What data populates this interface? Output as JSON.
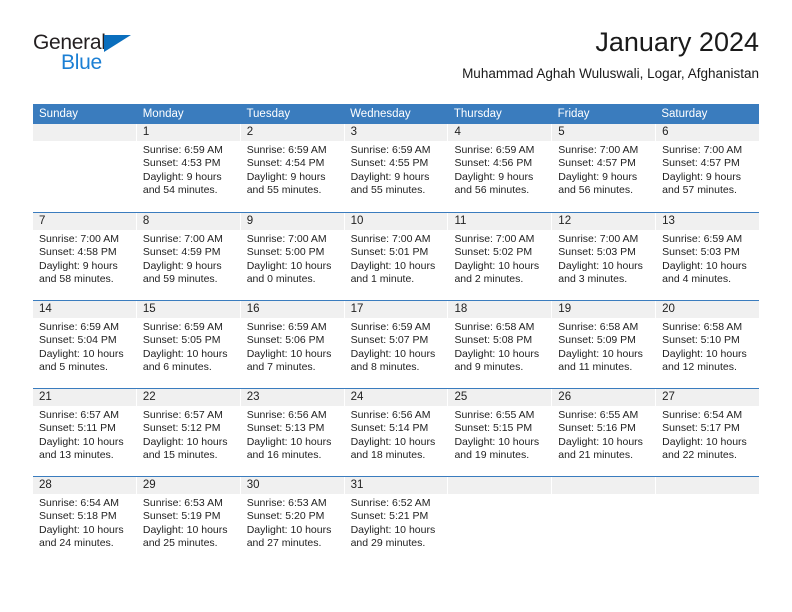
{
  "brand": {
    "name_top": "General",
    "name_bottom": "Blue",
    "triangle_icon": "brand-triangle-icon",
    "color_dark": "#231f20",
    "color_blue": "#1b7fd4"
  },
  "header": {
    "title": "January 2024",
    "subtitle": "Muhammad Aghah Wuluswali, Logar, Afghanistan"
  },
  "theme": {
    "header_blue": "#3a7cbe",
    "daynum_gray": "#f0f0f0",
    "text": "#222222"
  },
  "calendar": {
    "weekdays": [
      "Sunday",
      "Monday",
      "Tuesday",
      "Wednesday",
      "Thursday",
      "Friday",
      "Saturday"
    ],
    "weeks": [
      [
        {
          "day": "",
          "sunrise": "",
          "sunset": "",
          "daylight": ""
        },
        {
          "day": "1",
          "sunrise": "Sunrise: 6:59 AM",
          "sunset": "Sunset: 4:53 PM",
          "daylight": "Daylight: 9 hours and 54 minutes."
        },
        {
          "day": "2",
          "sunrise": "Sunrise: 6:59 AM",
          "sunset": "Sunset: 4:54 PM",
          "daylight": "Daylight: 9 hours and 55 minutes."
        },
        {
          "day": "3",
          "sunrise": "Sunrise: 6:59 AM",
          "sunset": "Sunset: 4:55 PM",
          "daylight": "Daylight: 9 hours and 55 minutes."
        },
        {
          "day": "4",
          "sunrise": "Sunrise: 6:59 AM",
          "sunset": "Sunset: 4:56 PM",
          "daylight": "Daylight: 9 hours and 56 minutes."
        },
        {
          "day": "5",
          "sunrise": "Sunrise: 7:00 AM",
          "sunset": "Sunset: 4:57 PM",
          "daylight": "Daylight: 9 hours and 56 minutes."
        },
        {
          "day": "6",
          "sunrise": "Sunrise: 7:00 AM",
          "sunset": "Sunset: 4:57 PM",
          "daylight": "Daylight: 9 hours and 57 minutes."
        }
      ],
      [
        {
          "day": "7",
          "sunrise": "Sunrise: 7:00 AM",
          "sunset": "Sunset: 4:58 PM",
          "daylight": "Daylight: 9 hours and 58 minutes."
        },
        {
          "day": "8",
          "sunrise": "Sunrise: 7:00 AM",
          "sunset": "Sunset: 4:59 PM",
          "daylight": "Daylight: 9 hours and 59 minutes."
        },
        {
          "day": "9",
          "sunrise": "Sunrise: 7:00 AM",
          "sunset": "Sunset: 5:00 PM",
          "daylight": "Daylight: 10 hours and 0 minutes."
        },
        {
          "day": "10",
          "sunrise": "Sunrise: 7:00 AM",
          "sunset": "Sunset: 5:01 PM",
          "daylight": "Daylight: 10 hours and 1 minute."
        },
        {
          "day": "11",
          "sunrise": "Sunrise: 7:00 AM",
          "sunset": "Sunset: 5:02 PM",
          "daylight": "Daylight: 10 hours and 2 minutes."
        },
        {
          "day": "12",
          "sunrise": "Sunrise: 7:00 AM",
          "sunset": "Sunset: 5:03 PM",
          "daylight": "Daylight: 10 hours and 3 minutes."
        },
        {
          "day": "13",
          "sunrise": "Sunrise: 6:59 AM",
          "sunset": "Sunset: 5:03 PM",
          "daylight": "Daylight: 10 hours and 4 minutes."
        }
      ],
      [
        {
          "day": "14",
          "sunrise": "Sunrise: 6:59 AM",
          "sunset": "Sunset: 5:04 PM",
          "daylight": "Daylight: 10 hours and 5 minutes."
        },
        {
          "day": "15",
          "sunrise": "Sunrise: 6:59 AM",
          "sunset": "Sunset: 5:05 PM",
          "daylight": "Daylight: 10 hours and 6 minutes."
        },
        {
          "day": "16",
          "sunrise": "Sunrise: 6:59 AM",
          "sunset": "Sunset: 5:06 PM",
          "daylight": "Daylight: 10 hours and 7 minutes."
        },
        {
          "day": "17",
          "sunrise": "Sunrise: 6:59 AM",
          "sunset": "Sunset: 5:07 PM",
          "daylight": "Daylight: 10 hours and 8 minutes."
        },
        {
          "day": "18",
          "sunrise": "Sunrise: 6:58 AM",
          "sunset": "Sunset: 5:08 PM",
          "daylight": "Daylight: 10 hours and 9 minutes."
        },
        {
          "day": "19",
          "sunrise": "Sunrise: 6:58 AM",
          "sunset": "Sunset: 5:09 PM",
          "daylight": "Daylight: 10 hours and 11 minutes."
        },
        {
          "day": "20",
          "sunrise": "Sunrise: 6:58 AM",
          "sunset": "Sunset: 5:10 PM",
          "daylight": "Daylight: 10 hours and 12 minutes."
        }
      ],
      [
        {
          "day": "21",
          "sunrise": "Sunrise: 6:57 AM",
          "sunset": "Sunset: 5:11 PM",
          "daylight": "Daylight: 10 hours and 13 minutes."
        },
        {
          "day": "22",
          "sunrise": "Sunrise: 6:57 AM",
          "sunset": "Sunset: 5:12 PM",
          "daylight": "Daylight: 10 hours and 15 minutes."
        },
        {
          "day": "23",
          "sunrise": "Sunrise: 6:56 AM",
          "sunset": "Sunset: 5:13 PM",
          "daylight": "Daylight: 10 hours and 16 minutes."
        },
        {
          "day": "24",
          "sunrise": "Sunrise: 6:56 AM",
          "sunset": "Sunset: 5:14 PM",
          "daylight": "Daylight: 10 hours and 18 minutes."
        },
        {
          "day": "25",
          "sunrise": "Sunrise: 6:55 AM",
          "sunset": "Sunset: 5:15 PM",
          "daylight": "Daylight: 10 hours and 19 minutes."
        },
        {
          "day": "26",
          "sunrise": "Sunrise: 6:55 AM",
          "sunset": "Sunset: 5:16 PM",
          "daylight": "Daylight: 10 hours and 21 minutes."
        },
        {
          "day": "27",
          "sunrise": "Sunrise: 6:54 AM",
          "sunset": "Sunset: 5:17 PM",
          "daylight": "Daylight: 10 hours and 22 minutes."
        }
      ],
      [
        {
          "day": "28",
          "sunrise": "Sunrise: 6:54 AM",
          "sunset": "Sunset: 5:18 PM",
          "daylight": "Daylight: 10 hours and 24 minutes."
        },
        {
          "day": "29",
          "sunrise": "Sunrise: 6:53 AM",
          "sunset": "Sunset: 5:19 PM",
          "daylight": "Daylight: 10 hours and 25 minutes."
        },
        {
          "day": "30",
          "sunrise": "Sunrise: 6:53 AM",
          "sunset": "Sunset: 5:20 PM",
          "daylight": "Daylight: 10 hours and 27 minutes."
        },
        {
          "day": "31",
          "sunrise": "Sunrise: 6:52 AM",
          "sunset": "Sunset: 5:21 PM",
          "daylight": "Daylight: 10 hours and 29 minutes."
        },
        {
          "day": "",
          "sunrise": "",
          "sunset": "",
          "daylight": ""
        },
        {
          "day": "",
          "sunrise": "",
          "sunset": "",
          "daylight": ""
        },
        {
          "day": "",
          "sunrise": "",
          "sunset": "",
          "daylight": ""
        }
      ]
    ]
  }
}
